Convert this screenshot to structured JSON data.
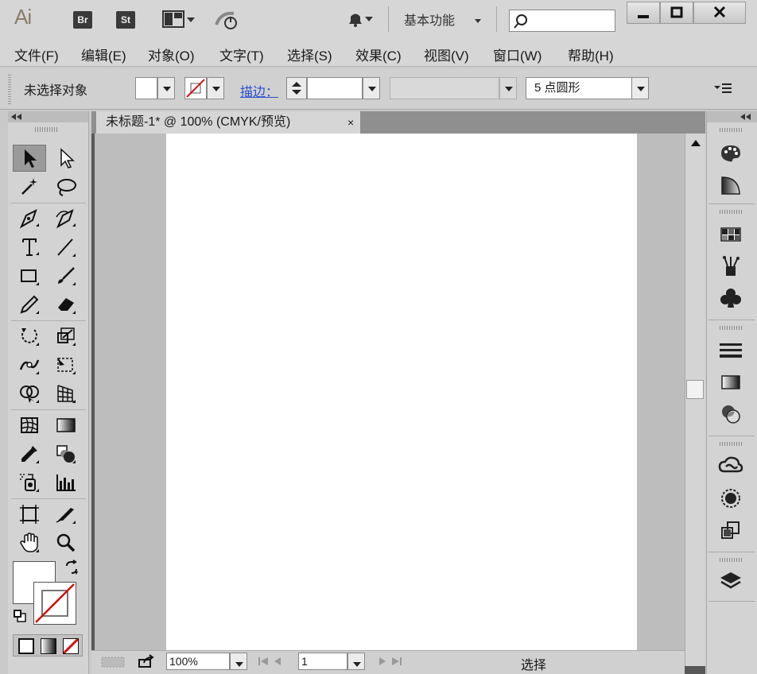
{
  "app": {
    "logo": "Ai",
    "bridge_label": "Br",
    "stock_label": "St",
    "workspace_label": "基本功能",
    "search_placeholder": ""
  },
  "menu": [
    "文件(F)",
    "编辑(E)",
    "对象(O)",
    "文字(T)",
    "选择(S)",
    "效果(C)",
    "视图(V)",
    "窗口(W)",
    "帮助(H)"
  ],
  "control": {
    "selection_label": "未选择对象",
    "stroke_label": "描边：",
    "brush_value": "5  点圆形"
  },
  "document": {
    "tab_title": "未标题-1* @ 100% (CMYK/预览)",
    "tab_close": "×"
  },
  "status": {
    "zoom": "100%",
    "artboard_number": "1",
    "status_text": "选择"
  },
  "colors": {
    "accent_link": "#2a4fd0",
    "panel_bg": "#d3d3d3",
    "pasteboard": "#bdbdbd",
    "no_fill_red": "#d01010"
  }
}
